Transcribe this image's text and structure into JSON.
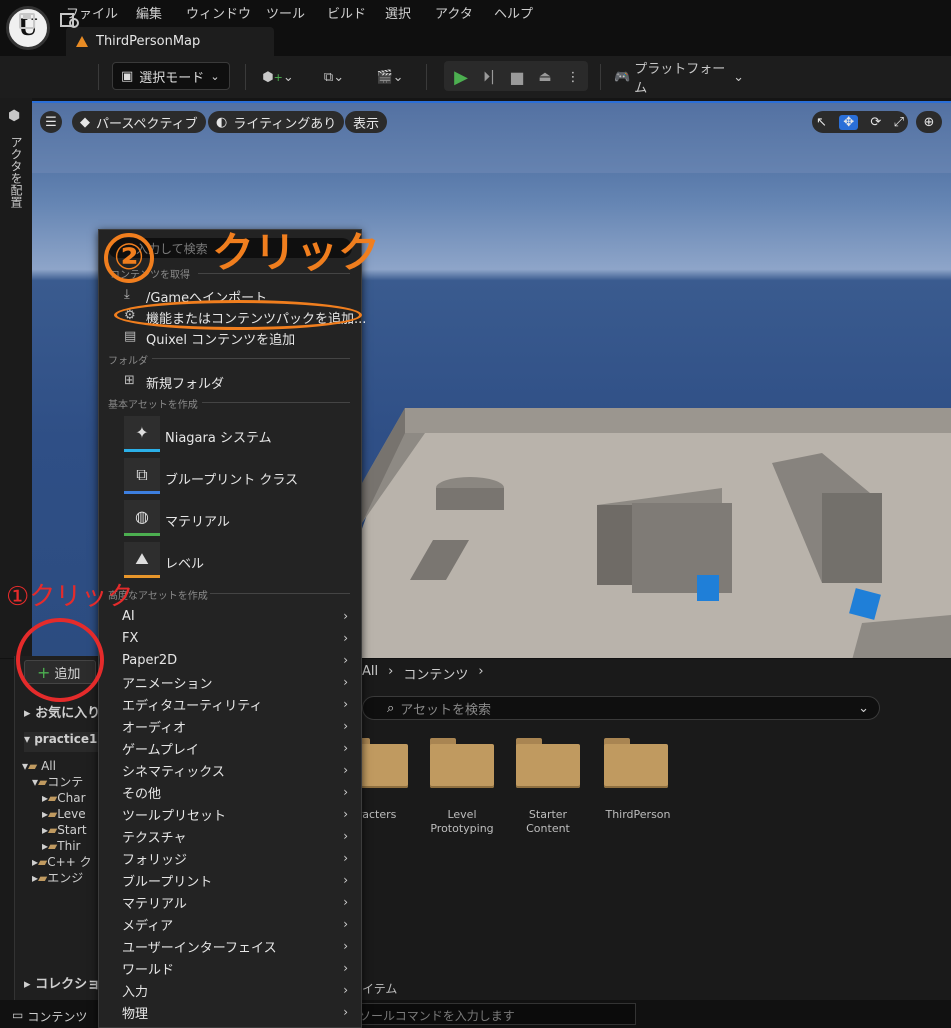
{
  "menu": {
    "items": [
      "ファイル",
      "編集",
      "ウィンドウ",
      "ツール",
      "ビルド",
      "選択",
      "アクタ",
      "ヘルプ"
    ],
    "logo": "U"
  },
  "tab": {
    "title": "ThirdPersonMap"
  },
  "toolbar": {
    "select_mode": "選択モード",
    "platform": "プラットフォーム"
  },
  "left_strip": {
    "label": "アクタを配置"
  },
  "viewport": {
    "perspective": "パースペクティブ",
    "lighting": "ライティングあり",
    "show": "表示"
  },
  "context_menu": {
    "search_placeholder": "入力して検索",
    "section_get_content": "コンテンツを取得",
    "import": "/Gameへインポート",
    "add_feature_pack": "機能またはコンテンツパックを追加...",
    "quixel": "Quixel コンテンツを追加",
    "section_folder": "フォルダ",
    "new_folder": "新規フォルダ",
    "section_basic": "基本アセットを作成",
    "basic_assets": [
      {
        "label": "Niagara システム",
        "icon": "niagara-icon",
        "color": "#2bb0e8"
      },
      {
        "label": "ブループリント クラス",
        "icon": "blueprint-icon",
        "color": "#3d7fe0"
      },
      {
        "label": "マテリアル",
        "icon": "material-icon",
        "color": "#4caf50"
      },
      {
        "label": "レベル",
        "icon": "level-icon",
        "color": "#e8962b"
      }
    ],
    "section_advanced": "高度なアセットを作成",
    "advanced_items": [
      "AI",
      "FX",
      "Paper2D",
      "アニメーション",
      "エディタユーティリティ",
      "オーディオ",
      "ゲームプレイ",
      "シネマティックス",
      "その他",
      "ツールプリセット",
      "テクスチャ",
      "フォリッジ",
      "ブループリント",
      "マテリアル",
      "メディア",
      "ユーザーインターフェイス",
      "ワールド",
      "入力",
      "物理"
    ]
  },
  "content_browser": {
    "add_button": "追加",
    "favorites": "お気に入り",
    "project": "practice1",
    "tree": [
      "All",
      "コンテ",
      "Char",
      "Leve",
      "Start",
      "Thir",
      "C++ ク",
      "エンジ"
    ],
    "collections": "コレクション",
    "breadcrumb": [
      "All",
      "コンテンツ"
    ],
    "search_placeholder": "アセットを検索",
    "folders": [
      {
        "label": "haracters"
      },
      {
        "label": "Level Prototyping"
      },
      {
        "label": "Starter Content"
      },
      {
        "label": "ThirdPerson"
      }
    ],
    "items_count_suffix": "イテム",
    "content_drawer": "コンテンツ",
    "console_placeholder": "ソールコマンドを入力します"
  },
  "annotations": {
    "step1": "①クリック",
    "step2_number": "②",
    "step2": "クリック"
  },
  "colors": {
    "accent_orange": "#f07e1e",
    "accent_red": "#e52b2b",
    "viewport_border": "#2a6fd8",
    "play_green": "#4caf50"
  }
}
